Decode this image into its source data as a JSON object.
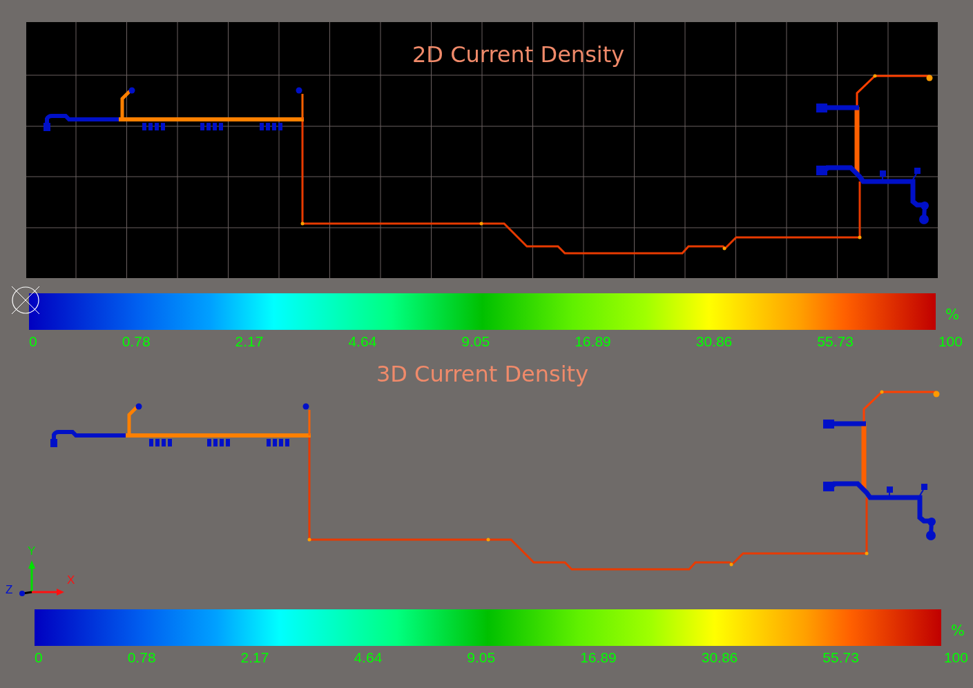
{
  "panels": [
    {
      "kind": "flat",
      "title": "2D Current Density",
      "colorbar": {
        "ticks": [
          "0",
          "0.78",
          "2.17",
          "4.64",
          "9.05",
          "16.89",
          "30.86",
          "55.73",
          "100"
        ],
        "unit": "%"
      }
    },
    {
      "kind": "spatial",
      "title": "3D Current Density",
      "axes": {
        "x": "X",
        "y": "Y",
        "z": "Z"
      },
      "colorbar": {
        "ticks": [
          "0",
          "0.78",
          "2.17",
          "4.64",
          "9.05",
          "16.89",
          "30.86",
          "55.73",
          "100"
        ],
        "unit": "%"
      }
    }
  ]
}
